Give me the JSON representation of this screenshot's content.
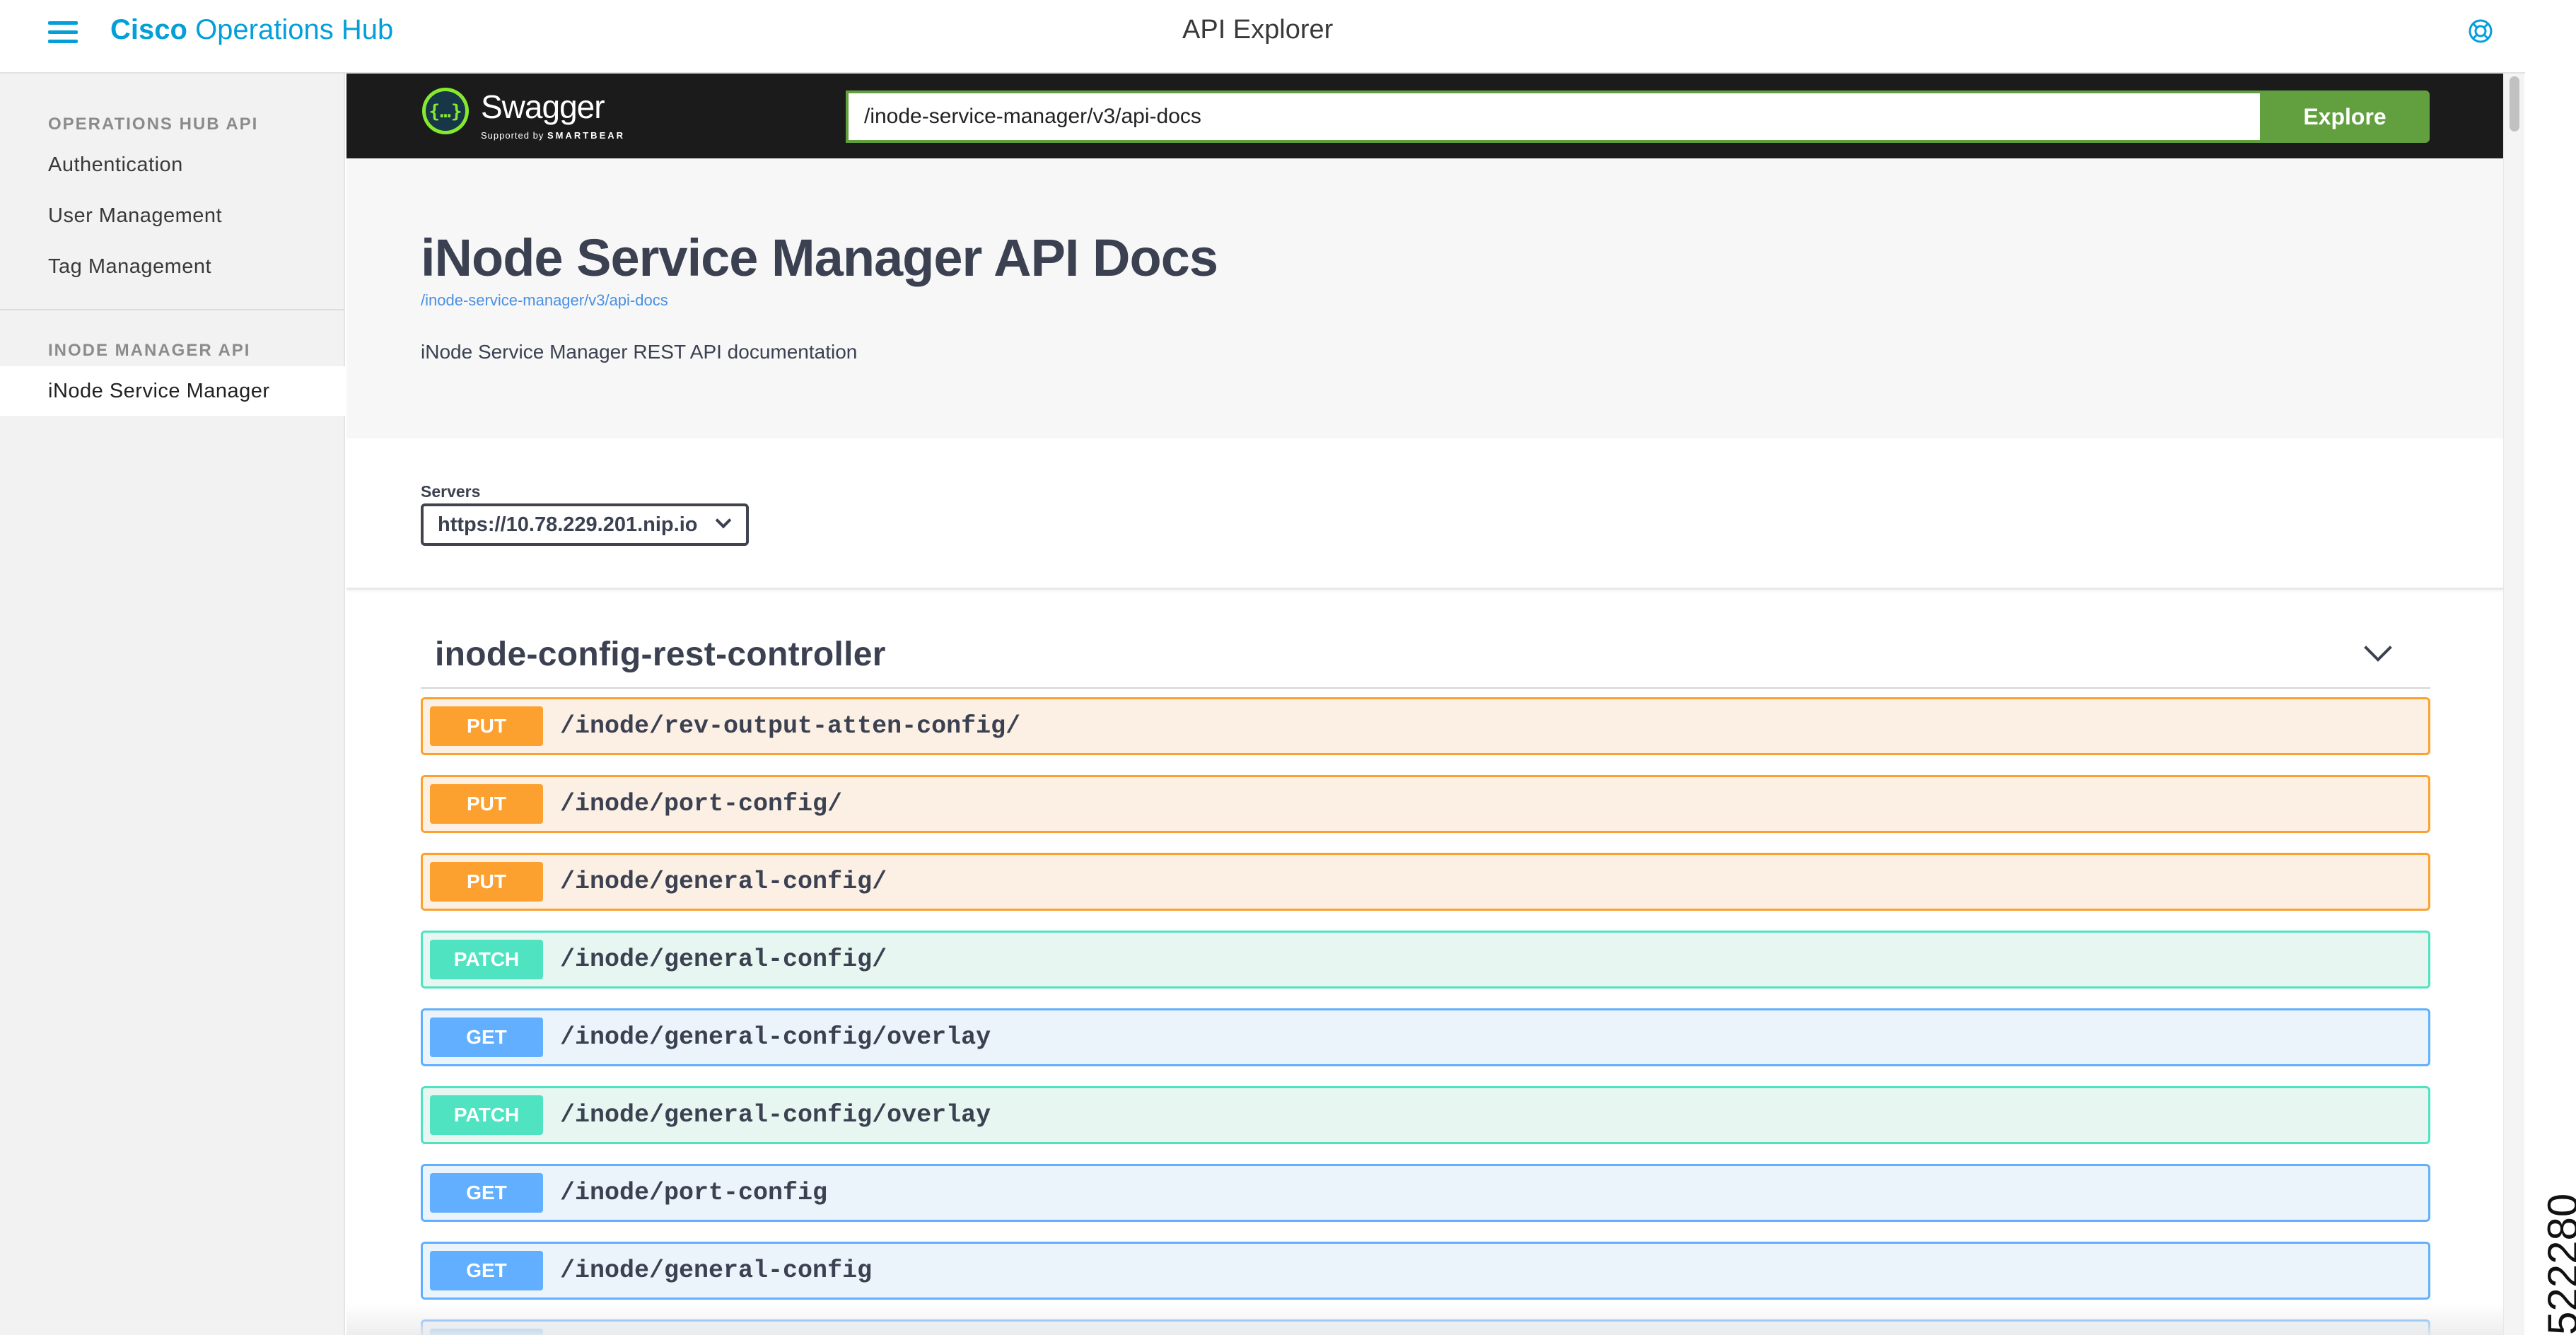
{
  "header": {
    "brand_bold": "Cisco",
    "brand_rest": "Operations Hub",
    "page_title": "API Explorer",
    "menu_icon": "hamburger-menu-icon",
    "help_icon": "help-lifebuoy-icon",
    "accent_color": "#049fd9"
  },
  "sidebar": {
    "sections": [
      {
        "title": "OPERATIONS HUB API",
        "items": [
          {
            "label": "Authentication"
          },
          {
            "label": "User Management"
          },
          {
            "label": "Tag Management"
          }
        ]
      },
      {
        "title": "INODE MANAGER API",
        "items": [
          {
            "label": "iNode Service Manager",
            "active": true
          }
        ]
      }
    ],
    "panel_toggle_icon": "sidebar-panel-icon"
  },
  "swagger": {
    "logo_text": "Swagger",
    "supported_by": "Supported by",
    "smartbear": "SMARTBEAR",
    "url_value": "/inode-service-manager/v3/api-docs",
    "explore_label": "Explore",
    "brand_color": "#62a03f"
  },
  "info": {
    "title": "iNode Service Manager API Docs",
    "link": "/inode-service-manager/v3/api-docs",
    "description": "iNode Service Manager REST API documentation"
  },
  "servers": {
    "label": "Servers",
    "selected": "https://10.78.229.201.nip.io"
  },
  "tag": {
    "name": "inode-config-rest-controller",
    "expanded": true
  },
  "operations": [
    {
      "method": "PUT",
      "path": "/inode/rev-output-atten-config/"
    },
    {
      "method": "PUT",
      "path": "/inode/port-config/"
    },
    {
      "method": "PUT",
      "path": "/inode/general-config/"
    },
    {
      "method": "PATCH",
      "path": "/inode/general-config/"
    },
    {
      "method": "GET",
      "path": "/inode/general-config/overlay"
    },
    {
      "method": "PATCH",
      "path": "/inode/general-config/overlay"
    },
    {
      "method": "GET",
      "path": "/inode/port-config"
    },
    {
      "method": "GET",
      "path": "/inode/general-config"
    }
  ],
  "method_colors": {
    "PUT": "#fca130",
    "PATCH": "#50e3c2",
    "GET": "#61affe"
  },
  "figure_id": "522280"
}
